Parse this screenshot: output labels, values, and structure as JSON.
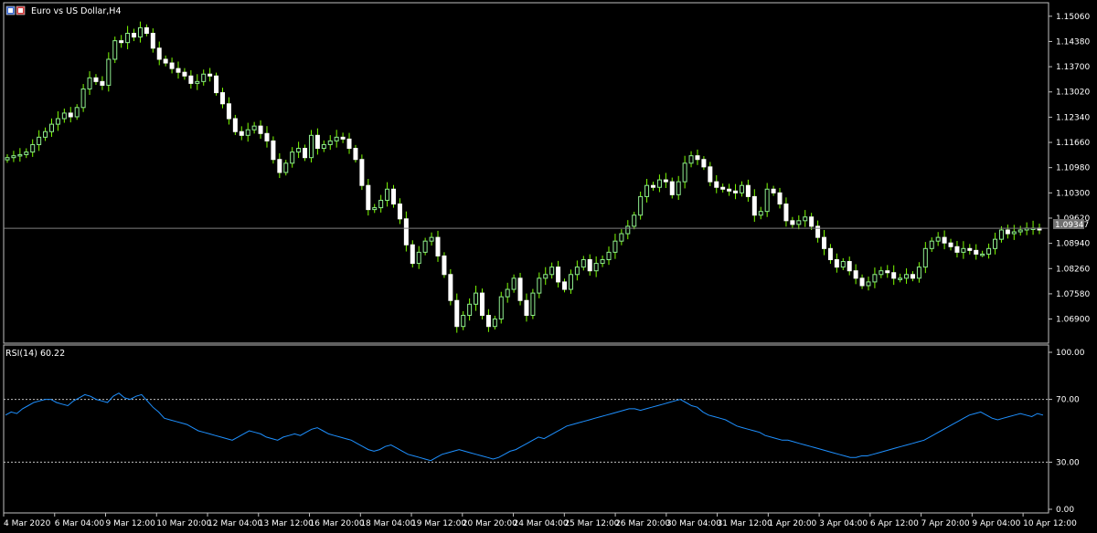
{
  "window": {
    "title": "Euro vs US Dollar,H4",
    "icon": "chart-window-icon"
  },
  "price_tag": "1.09347",
  "rsi_label": "RSI(14) 60.22",
  "colors": {
    "background": "#000000",
    "bull_candle": "#90ee90",
    "bear_candle": "#ffffff",
    "wick": "#7CFC00",
    "rsi_line": "#1e90ff",
    "level_line": "#c0c0c0",
    "bid_line": "#808080",
    "frame": "#c0c0c0"
  },
  "chart_data": [
    {
      "type": "candlestick",
      "title": "Euro vs US Dollar,H4",
      "ylim": [
        1.0625,
        1.1535
      ],
      "y_ticks": [
        "1.15060",
        "1.14380",
        "1.13700",
        "1.13020",
        "1.12340",
        "1.11660",
        "1.10980",
        "1.10300",
        "1.09620",
        "1.08940",
        "1.08260",
        "1.07580",
        "1.06900"
      ],
      "current_price": 1.09347,
      "x_ticks": [
        "4 Mar 2020",
        "6 Mar 04:00",
        "9 Mar 12:00",
        "10 Mar 20:00",
        "12 Mar 04:00",
        "13 Mar 12:00",
        "16 Mar 20:00",
        "18 Mar 04:00",
        "19 Mar 12:00",
        "20 Mar 20:00",
        "24 Mar 04:00",
        "25 Mar 12:00",
        "26 Mar 20:00",
        "30 Mar 04:00",
        "31 Mar 12:00",
        "1 Apr 20:00",
        "3 Apr 04:00",
        "6 Apr 12:00",
        "7 Apr 20:00",
        "9 Apr 04:00",
        "10 Apr 12:00"
      ],
      "closes": [
        1.1125,
        1.113,
        1.1133,
        1.114,
        1.116,
        1.118,
        1.1195,
        1.1215,
        1.123,
        1.1245,
        1.1235,
        1.126,
        1.131,
        1.134,
        1.133,
        1.132,
        1.139,
        1.144,
        1.1435,
        1.146,
        1.145,
        1.1475,
        1.146,
        1.142,
        1.139,
        1.138,
        1.1365,
        1.1355,
        1.1345,
        1.1325,
        1.133,
        1.135,
        1.1345,
        1.13,
        1.127,
        1.123,
        1.1195,
        1.1185,
        1.12,
        1.121,
        1.119,
        1.117,
        1.112,
        1.1085,
        1.111,
        1.114,
        1.115,
        1.1125,
        1.1185,
        1.115,
        1.116,
        1.117,
        1.118,
        1.1175,
        1.115,
        1.112,
        1.105,
        1.0985,
        1.099,
        1.101,
        1.104,
        1.1,
        1.096,
        1.089,
        1.084,
        1.087,
        1.09,
        1.091,
        1.086,
        1.081,
        1.074,
        1.067,
        1.07,
        1.073,
        1.076,
        1.07,
        1.067,
        1.069,
        1.075,
        1.077,
        1.08,
        1.074,
        1.07,
        1.076,
        1.08,
        1.081,
        1.083,
        1.079,
        1.077,
        1.081,
        1.083,
        1.085,
        1.082,
        1.084,
        1.085,
        1.087,
        1.09,
        1.092,
        1.094,
        1.097,
        1.102,
        1.105,
        1.1045,
        1.1065,
        1.106,
        1.1025,
        1.106,
        1.111,
        1.113,
        1.112,
        1.11,
        1.106,
        1.1045,
        1.104,
        1.1035,
        1.103,
        1.105,
        1.102,
        1.097,
        1.098,
        1.104,
        1.103,
        1.1,
        1.0955,
        1.0945,
        1.0955,
        1.0965,
        1.094,
        1.091,
        1.088,
        1.085,
        1.083,
        1.0845,
        1.082,
        1.08,
        1.078,
        1.079,
        1.081,
        1.082,
        1.0815,
        1.08,
        1.08,
        1.081,
        1.08,
        1.083,
        1.088,
        1.09,
        1.091,
        1.0895,
        1.0885,
        1.087,
        1.088,
        1.0875,
        1.0865,
        1.0865,
        1.088,
        1.0905,
        1.093,
        1.092,
        1.0925,
        1.093,
        1.0935,
        1.0935,
        1.093
      ]
    },
    {
      "type": "line",
      "title": "RSI(14) 60.22",
      "ylim": [
        0,
        100
      ],
      "y_ticks": [
        "100.00",
        "70.00",
        "30.00",
        "0.00"
      ],
      "levels": [
        70,
        30
      ],
      "values": [
        60,
        62,
        61,
        64,
        66,
        68,
        69,
        70,
        70,
        68,
        67,
        66,
        69,
        71,
        73,
        72,
        70,
        69,
        68,
        72,
        74,
        71,
        70,
        72,
        73,
        69,
        65,
        62,
        58,
        57,
        56,
        55,
        54,
        52,
        50,
        49,
        48,
        47,
        46,
        45,
        44,
        46,
        48,
        50,
        49,
        48,
        46,
        45,
        44,
        46,
        47,
        48,
        47,
        49,
        51,
        52,
        50,
        48,
        47,
        46,
        45,
        44,
        42,
        40,
        38,
        37,
        38,
        40,
        41,
        39,
        37,
        35,
        34,
        33,
        32,
        31,
        33,
        35,
        36,
        37,
        38,
        37,
        36,
        35,
        34,
        33,
        32,
        33,
        35,
        37,
        38,
        40,
        42,
        44,
        46,
        45,
        47,
        49,
        51,
        53,
        54,
        55,
        56,
        57,
        58,
        59,
        60,
        61,
        62,
        63,
        64,
        64,
        63,
        64,
        65,
        66,
        67,
        68,
        69,
        70,
        68,
        66,
        65,
        62,
        60,
        59,
        58,
        57,
        55,
        53,
        52,
        51,
        50,
        49,
        47,
        46,
        45,
        44,
        44,
        43,
        42,
        41,
        40,
        39,
        38,
        37,
        36,
        35,
        34,
        33,
        33,
        34,
        34,
        35,
        36,
        37,
        38,
        39,
        40,
        41,
        42,
        43,
        44,
        46,
        48,
        50,
        52,
        54,
        56,
        58,
        60,
        61,
        62,
        60,
        58,
        57,
        58,
        59,
        60,
        61,
        60,
        59,
        61,
        60
      ]
    }
  ]
}
